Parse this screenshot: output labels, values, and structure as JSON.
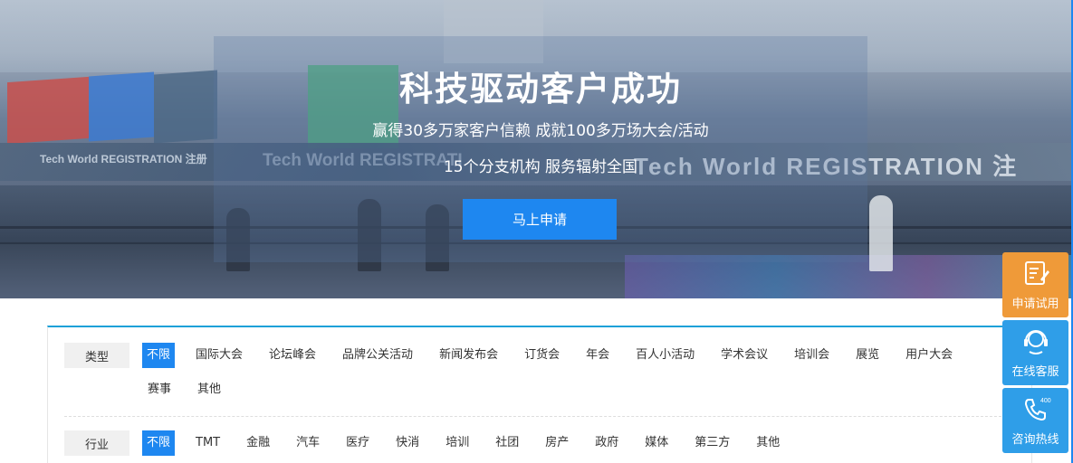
{
  "hero": {
    "title": "科技驱动客户成功",
    "subtitle_1": "赢得30多万家客户信赖 成就100多万场大会/活动",
    "subtitle_2": "15个分支机构 服务辐射全国",
    "cta_label": "马上申请",
    "background_text": {
      "registration_large": "Tech World REGISTRATION 注",
      "registration_mid": "Tech World REGISTRATI",
      "registration_small": "Tech World REGISTRATION 注册"
    }
  },
  "filters": {
    "type": {
      "label": "类型",
      "options": [
        "不限",
        "国际大会",
        "论坛峰会",
        "品牌公关活动",
        "新闻发布会",
        "订货会",
        "年会",
        "百人小活动",
        "学术会议",
        "培训会",
        "展览",
        "用户大会",
        "赛事",
        "其他"
      ],
      "selected": "不限"
    },
    "industry": {
      "label": "行业",
      "options": [
        "不限",
        "TMT",
        "金融",
        "汽车",
        "医疗",
        "快消",
        "培训",
        "社团",
        "房产",
        "政府",
        "媒体",
        "第三方",
        "其他"
      ],
      "selected": "不限"
    }
  },
  "float_toolbar": [
    {
      "label": "申请试用",
      "icon": "form-edit-icon",
      "color": "#ef9a39"
    },
    {
      "label": "在线客服",
      "icon": "headset-icon",
      "color": "#2f9ee8"
    },
    {
      "label": "咨询热线",
      "icon": "phone-400-icon",
      "color": "#2f9ee8"
    }
  ],
  "colors": {
    "accent": "#1e87f0",
    "panel_border": "#1aa0d8",
    "label_bg": "#f0f0f0"
  }
}
